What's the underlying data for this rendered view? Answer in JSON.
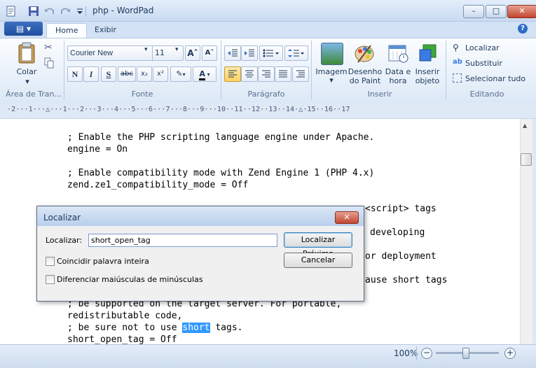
{
  "window": {
    "title": "php - WordPad",
    "controls": {
      "minimize": "–",
      "maximize": "□",
      "close": "✕"
    }
  },
  "quick_access": {
    "app_icon": "wordpad-icon",
    "save_icon": "save-icon",
    "undo_icon": "undo-icon",
    "redo_icon": "redo-icon",
    "customize_icon": "dropdown-icon"
  },
  "app_button": {
    "label": "▤ ▾"
  },
  "tabs": [
    {
      "label": "Home"
    },
    {
      "label": "Exibir"
    }
  ],
  "help": {
    "label": "?"
  },
  "ribbon": {
    "clipboard": {
      "paste_label": "Colar",
      "group_label": "Área de Tran..."
    },
    "font": {
      "family": "Courier New",
      "size": "11",
      "grow": "A˄",
      "shrink": "A˅",
      "bold": "N",
      "italic": "I",
      "underline": "S",
      "strike": "abc",
      "subscript": "x₂",
      "superscript": "x²",
      "highlight": "✎",
      "color": "A",
      "group_label": "Fonte"
    },
    "paragraph": {
      "group_label": "Parágrafo"
    },
    "insert": {
      "image": "Imagem",
      "paint": "Desenho do Paint",
      "datetime": "Data e hora",
      "object": "Inserir objeto",
      "group_label": "Inserir"
    },
    "editing": {
      "find": "Localizar",
      "replace": "Substituir",
      "select_all": "Selecionar tudo",
      "group_label": "Editando"
    }
  },
  "ruler": {
    "text": "·2···1···△···1···2···3···4···5···6···7···8···9···10··11··12··13··14·△·15··16··17"
  },
  "document": {
    "lines": [
      "; Enable the PHP scripting language engine under Apache.",
      "engine = On",
      "; Enable compatibility mode with Zend Engine 1 (PHP 4.x)",
      "zend.ze1_compatibility_mode = Off",
      "<script> tags",
      "developing",
      "or deployment",
      "ause short tags",
      "; be supported on the target server. For portable,",
      "redistributable code,",
      "; be sure not to use ",
      "short",
      " tags.",
      "short_open_tag = Off"
    ]
  },
  "status": {
    "zoom": "100%",
    "zoom_out": "−",
    "zoom_in": "+",
    "zoom_level_percent": 100
  },
  "dialog": {
    "title": "Localizar",
    "close": "✕",
    "find_label": "Localizar:",
    "find_value": "short_open_tag",
    "find_next": "Localizar Próxima",
    "cancel": "Cancelar",
    "match_word": "Coincidir palavra inteira",
    "match_case": "Diferenciar maiúsculas de minúsculas"
  }
}
